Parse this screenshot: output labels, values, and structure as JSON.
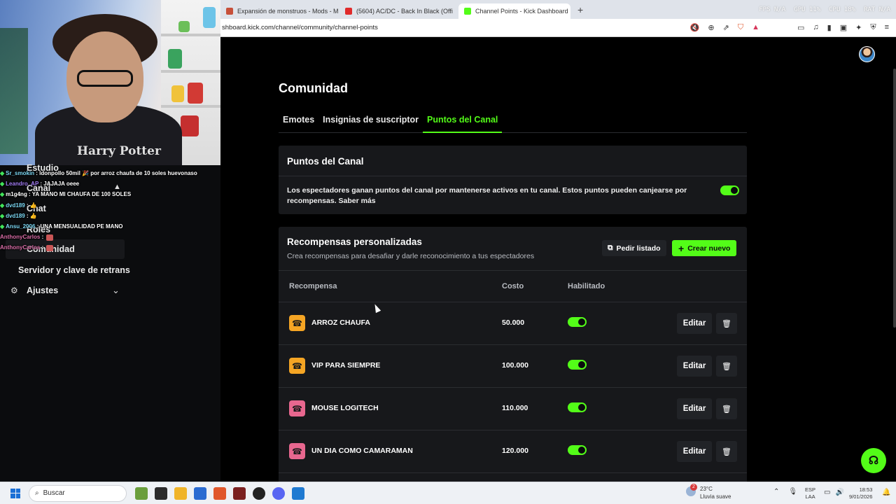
{
  "browser": {
    "tabs": [
      {
        "label": "Expansión de monstruos - Mods - M",
        "fav": "#c7503a"
      },
      {
        "label": "(5604) AC/DC - Back In Black (Offi",
        "fav": "#e02b2b"
      },
      {
        "label": "Channel Points - Kick Dashboard",
        "fav": "#53fc18",
        "active": true
      }
    ],
    "new_tab": "+",
    "close": "✕",
    "stats": [
      "FPS N/A",
      "GPU 11%",
      "CPU 18%",
      "RAT N/A"
    ],
    "url": "shboard.kick.com/channel/community/channel-points"
  },
  "webcam": {
    "shirt_text": "Harry Potter"
  },
  "sidebar": {
    "items": [
      {
        "label": "Estudio"
      },
      {
        "label": "Canal"
      },
      {
        "label": "Chat"
      },
      {
        "label": "Roles"
      },
      {
        "label": "Comunidad"
      },
      {
        "label": "Servidor y clave de retrans"
      },
      {
        "label": "Ajustes"
      }
    ]
  },
  "chat": [
    {
      "user": "Sr_smokin",
      "msg": "ldonpollo 50mil 🎉 por arroz chaufa de 10 soles huevonaso",
      "color": "user-g",
      "diamond": true
    },
    {
      "user": "Leandro_AP",
      "msg": "JAJAJA oeee",
      "color": "user-v",
      "diamond": true
    },
    {
      "user": "m1g4ng",
      "msg": "YA MANO MI CHAUFA DE 100 SOLES",
      "color": "user-w",
      "diamond": true
    },
    {
      "user": "dvd189",
      "msg": "👍",
      "color": "user-g",
      "diamond": true
    },
    {
      "user": "dvd189",
      "msg": "👍",
      "color": "user-g",
      "diamond": true
    },
    {
      "user": "Ansu_2006",
      "msg": "UNA MENSUALIDAD PE MANO",
      "color": "user-g",
      "diamond": true
    },
    {
      "user": "AnthonyCarlos",
      "msg": "",
      "color": "user-p",
      "diamond": false
    },
    {
      "user": "AnthonyCarlos",
      "msg": "",
      "color": "user-p",
      "diamond": false
    }
  ],
  "page": {
    "title": "Comunidad",
    "tabs": [
      {
        "label": "Emotes"
      },
      {
        "label": "Insignias de suscriptor"
      },
      {
        "label": "Puntos del Canal",
        "active": true
      }
    ]
  },
  "points_card": {
    "title": "Puntos del Canal",
    "description": "Los espectadores ganan puntos del canal por mantenerse activos en tu canal. Estos puntos pueden canjearse por recompensas. Saber más",
    "enabled": true
  },
  "rewards_card": {
    "title": "Recompensas personalizadas",
    "subtitle": "Crea recompensas para desafiar y darle reconocimiento a tus espectadores",
    "list_button": "Pedir listado",
    "new_button": "Crear nuevo",
    "columns": {
      "reward": "Recompensa",
      "cost": "Costo",
      "enabled": "Habilitado"
    },
    "rows": [
      {
        "name": "ARROZ CHAUFA",
        "cost": "50.000",
        "color": "#f5a524",
        "enabled": true
      },
      {
        "name": "VIP PARA SIEMPRE",
        "cost": "100.000",
        "color": "#f5a524",
        "enabled": true
      },
      {
        "name": "MOUSE LOGITECH",
        "cost": "110.000",
        "color": "#e8678f",
        "enabled": true
      },
      {
        "name": "UN DIA COMO CAMARAMAN",
        "cost": "120.000",
        "color": "#e8678f",
        "enabled": true
      }
    ],
    "edit_label": "Editar"
  },
  "taskbar": {
    "search_placeholder": "Buscar",
    "weather_temp": "23°C",
    "weather_desc": "Lluvia suave",
    "weather_badge": "2",
    "lang_top": "ESP",
    "lang_bottom": "LAA",
    "time": "18:53",
    "date": "9/01/2026"
  }
}
